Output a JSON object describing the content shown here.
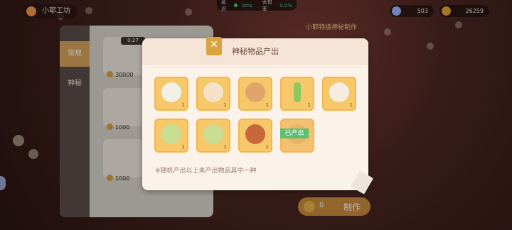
{
  "status": {
    "ping_label": "延迟",
    "ping_value": "0ms",
    "loss_label": "丢包率",
    "loss_value": "0.0%"
  },
  "workshop": {
    "title": "小耶工坊"
  },
  "currency": [
    {
      "value": "503",
      "icon": "sparkle-icon",
      "color": "#9fb7ff"
    },
    {
      "value": "26259",
      "icon": "coin-icon",
      "color": "#e3a340"
    }
  ],
  "left_panel": {
    "tabs": [
      {
        "label": "常规"
      },
      {
        "label": "神秘"
      }
    ],
    "timer": "0:27",
    "prices": [
      "30000",
      "1000",
      "1000"
    ]
  },
  "special_title": "小耶特级神秘制作",
  "make_button": {
    "count": "0",
    "label": "制作"
  },
  "modal": {
    "title": "神秘物品产出",
    "close_label": "✕",
    "items": [
      {
        "icon": "shirt-icon",
        "qty": "1"
      },
      {
        "icon": "dress-icon",
        "qty": "1"
      },
      {
        "icon": "shoes-icon",
        "qty": "1"
      },
      {
        "icon": "wand-icon",
        "qty": "1"
      },
      {
        "icon": "hat-icon",
        "qty": "1"
      },
      {
        "icon": "green-hair-braid-icon",
        "qty": "1"
      },
      {
        "icon": "green-hair-icon",
        "qty": "1"
      },
      {
        "icon": "orange-hair-icon",
        "qty": "1"
      },
      {
        "icon": "hair-silhouette-icon",
        "qty": ""
      }
    ],
    "done_badge": "已产出",
    "note": "※随机产出以上未产出物品其中一种"
  },
  "colors": {
    "accent": "#d9a33e",
    "tile": "#f7c86a",
    "done": "#5cc070"
  }
}
